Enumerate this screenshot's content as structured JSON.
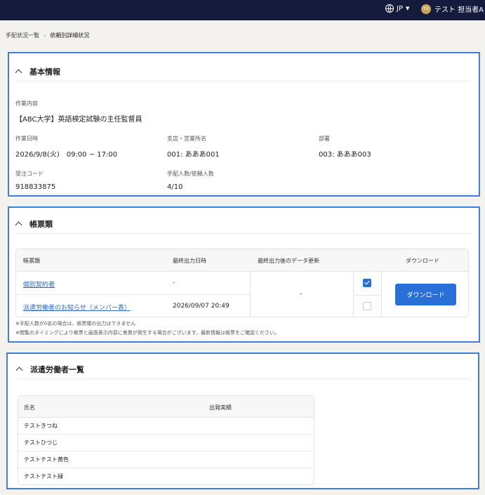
{
  "header": {
    "language": "JP",
    "user": {
      "avatar_initials": "YU",
      "name": "テスト 担当者A"
    }
  },
  "breadcrumb": {
    "parent": "手配状況一覧",
    "separator": "›",
    "current": "依頼別詳細状況"
  },
  "basic_info": {
    "title": "基本情報",
    "work_content": {
      "label": "作業内容",
      "value": "【ABC大学】英語検定試験の主任監督員"
    },
    "work_datetime": {
      "label": "作業日時",
      "value": "2026/9/8(火)　09:00 ~ 17:00"
    },
    "branch": {
      "label": "支店・営業所名",
      "value": "001: あああ001"
    },
    "department": {
      "label": "部署",
      "value": "003: あああ003"
    },
    "order_code": {
      "label": "受注コード",
      "value": "918833875"
    },
    "headcount": {
      "label": "手配人数/依頼人数",
      "value": "4/10"
    }
  },
  "documents": {
    "title": "帳票類",
    "columns": {
      "name": "帳票類",
      "last_output": "最終出力日時",
      "data_updated": "最終出力後のデータ更新",
      "download": "ダウンロード"
    },
    "rows": [
      {
        "name": "個別契約者",
        "last_output": "-",
        "checked": true
      },
      {
        "name": "派遣労働者のお知らせ（メンバー表）",
        "last_output": "2026/09/07 20:49",
        "checked": false
      }
    ],
    "data_updated_value": "-",
    "download_button": "ダウンロード",
    "notes": [
      "※手配人数が0名の場合は、帳票類の出力はできません",
      "※閲覧のタイミングにより帳票と画面表示内容に差異が発生する場合がございます。最新情報は帳票をご確認ください。"
    ]
  },
  "workers": {
    "title": "派遣労働者一覧",
    "columns": {
      "name": "氏名",
      "departure": "出発実績"
    },
    "rows": [
      {
        "name": "テストきつね",
        "departure": ""
      },
      {
        "name": "テストひつじ",
        "departure": ""
      },
      {
        "name": "テストテスト黄色",
        "departure": ""
      },
      {
        "name": "テストテスト緑",
        "departure": ""
      }
    ]
  }
}
